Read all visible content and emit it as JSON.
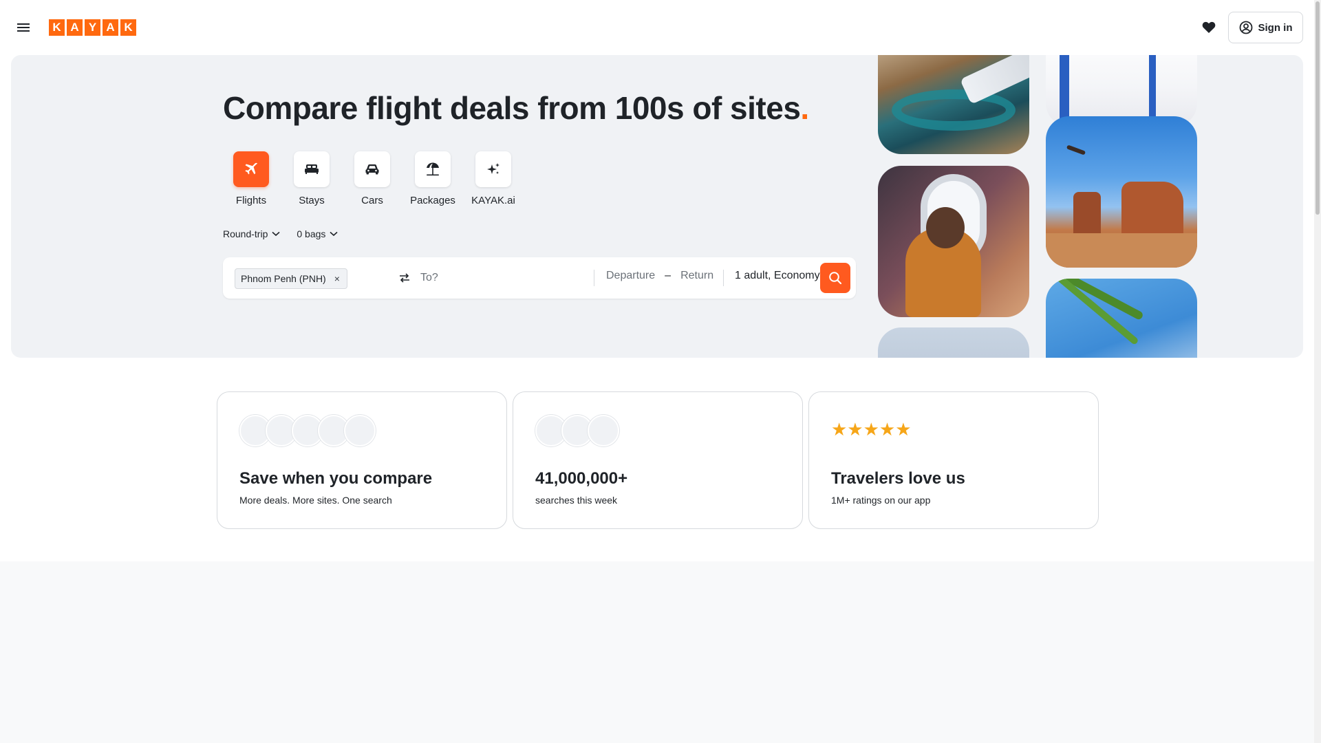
{
  "header": {
    "logo_letters": [
      "K",
      "A",
      "Y",
      "A",
      "K"
    ],
    "menu_icon": "hamburger-menu-icon",
    "favorites_icon": "heart-icon",
    "signin_label": "Sign in",
    "signin_icon": "user-circle-icon"
  },
  "hero": {
    "title": "Compare flight deals from 100s of sites",
    "title_dot": ".",
    "accent_color": "#ff690f",
    "verticals": [
      {
        "label": "Flights",
        "icon": "airplane-icon",
        "active": true
      },
      {
        "label": "Stays",
        "icon": "bed-icon",
        "active": false
      },
      {
        "label": "Cars",
        "icon": "car-icon",
        "active": false
      },
      {
        "label": "Packages",
        "icon": "beach-umbrella-icon",
        "active": false
      },
      {
        "label": "KAYAK.ai",
        "icon": "sparkle-icon",
        "active": false
      }
    ],
    "trip_type": "Round-trip",
    "bags": "0 bags"
  },
  "search": {
    "origin": "Phnom Penh (PNH)",
    "origin_remove": "×",
    "destination_placeholder": "To?",
    "departure": "Departure",
    "date_separator": "–",
    "return": "Return",
    "travelers": "1 adult, Economy",
    "search_icon": "search-icon"
  },
  "cards": [
    {
      "title": "Save when you compare",
      "subtitle": "More deals. More sites. One search",
      "avatar_count": 5
    },
    {
      "title": "41,000,000+",
      "subtitle": "searches this week",
      "avatar_count": 3
    },
    {
      "title": "Travelers love us",
      "subtitle": "1M+ ratings on our app",
      "stars": "★★★★★"
    }
  ]
}
